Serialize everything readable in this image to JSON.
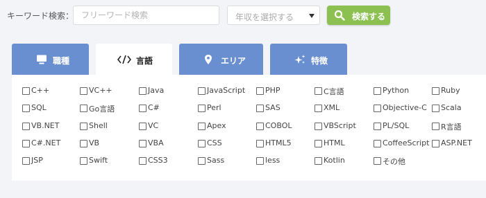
{
  "search": {
    "keyword_label": "キーワード検索：",
    "keyword_placeholder": "フリーワード検索",
    "income_select_value": "年収を選択する",
    "search_button_label": "検索する"
  },
  "tabs": [
    {
      "label": "職種",
      "icon": "monitor-icon",
      "active": false
    },
    {
      "label": "言語",
      "icon": "code-icon",
      "active": true
    },
    {
      "label": "エリア",
      "icon": "map-pin-icon",
      "active": false
    },
    {
      "label": "特徴",
      "icon": "sparkle-icon",
      "active": false
    }
  ],
  "languages": [
    [
      "C++",
      "VC++",
      "Java",
      "JavaScript",
      "PHP",
      "C言語",
      "Python",
      "Ruby"
    ],
    [
      "SQL",
      "Go言語",
      "C#",
      "Perl",
      "SAS",
      "XML",
      "Objective-C",
      "Scala"
    ],
    [
      "VB.NET",
      "Shell",
      "VC",
      "Apex",
      "COBOL",
      "VBScript",
      "PL/SQL",
      "R言語"
    ],
    [
      "C#.NET",
      "VB",
      "VBA",
      "CSS",
      "HTML5",
      "HTML",
      "CoffeeScript",
      "ASP.NET"
    ],
    [
      "JSP",
      "Swift",
      "CSS3",
      "Sass",
      "less",
      "Kotlin",
      "その他"
    ]
  ],
  "colors": {
    "tab_blue": "#6a8fd1",
    "search_green": "#8cc152",
    "page_background": "#f3f4f8"
  }
}
